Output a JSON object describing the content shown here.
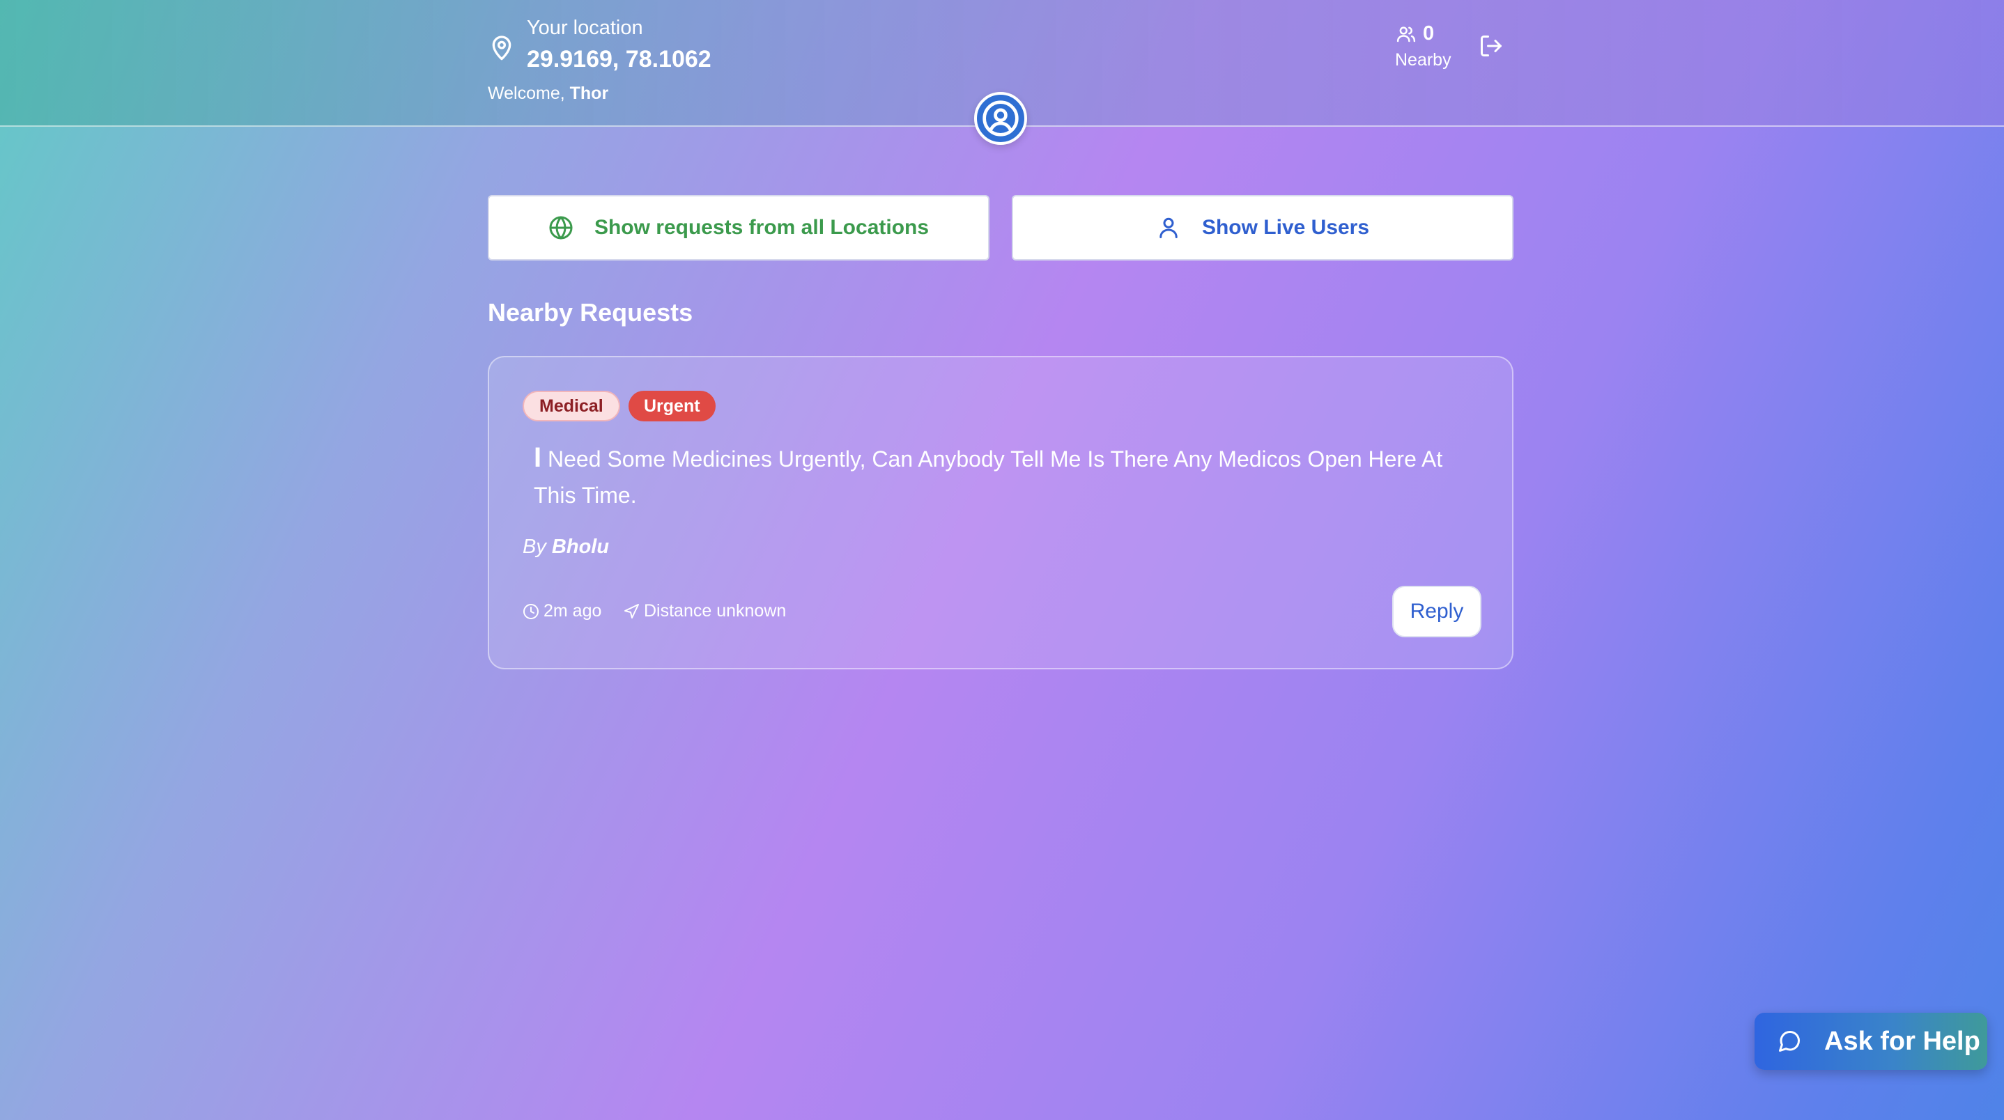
{
  "header": {
    "location_label": "Your location",
    "coordinates": "29.9169, 78.1062",
    "welcome_prefix": "Welcome, ",
    "username": "Thor",
    "nearby_count": "0",
    "nearby_label": "Nearby"
  },
  "actions": {
    "all_locations_label": "Show requests from all Locations",
    "live_users_label": "Show Live Users"
  },
  "section": {
    "title": "Nearby Requests"
  },
  "requests": [
    {
      "tags": [
        "Medical",
        "Urgent"
      ],
      "text_first": "I",
      "text_rest": " Need Some Medicines Urgently, Can Anybody Tell Me Is There Any Medicos Open Here At This Time.",
      "by_prefix": "By ",
      "author": "Bholu",
      "time": "2m ago",
      "distance": "Distance unknown",
      "reply_label": "Reply"
    }
  ],
  "help_button": {
    "label": "Ask for Help"
  },
  "colors": {
    "green_accent": "#3b9a4c",
    "blue_accent": "#2f5fcf",
    "urgent_red": "#e04a45",
    "medical_pink": "#fbe0e2"
  },
  "icons": [
    "map-pin-icon",
    "users-icon",
    "logout-icon",
    "user-avatar-icon",
    "globe-icon",
    "user-icon",
    "clock-icon",
    "navigation-arrow-icon",
    "chat-bubble-icon"
  ]
}
